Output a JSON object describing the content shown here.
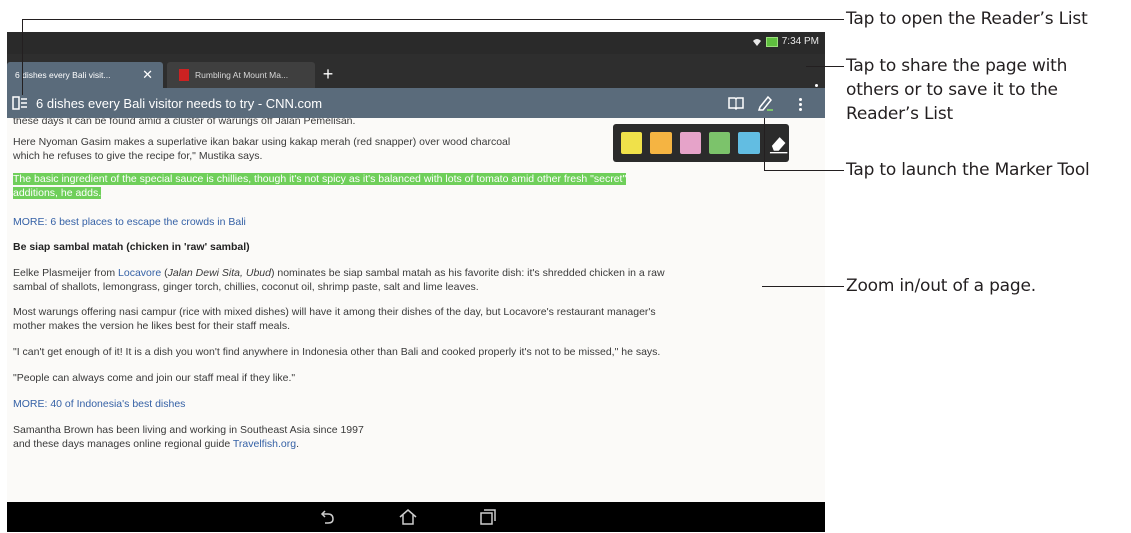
{
  "status": {
    "time": "7:34 PM"
  },
  "tabs": [
    {
      "label": "6 dishes every Bali visit...",
      "close": "✕"
    },
    {
      "label": "Rumbling At Mount Ma..."
    }
  ],
  "newtab_label": "+",
  "url_bar": {
    "title": "6 dishes every Bali visitor needs to try - CNN.com"
  },
  "article": {
    "para_top": "these days it can be found amid a cluster of warungs off Jalan Pemelisan.",
    "para_nyoman_1": "Here Nyoman Gasim makes a superlative ikan bakar using kakap merah (red snapper) over wood charcoal",
    "para_nyoman_2": "which he refuses to give the recipe for,\" Mustika says.",
    "highlight_1": "The basic ingredient of the special sauce is chillies, though it's not spicy as it's balanced with lots of tomato amid other fresh \"secret\"",
    "highlight_2": "additions, he adds.",
    "more_1": "MORE: 6 best places to escape the crowds in Bali",
    "heading": "Be siap sambal matah (chicken in 'raw' sambal)",
    "eelke_a": "Eelke Plasmeijer from ",
    "eelke_link": "Locavore",
    "eelke_b": " (",
    "eelke_italic": "Jalan Dewi Sita, Ubud",
    "eelke_c": ") nominates be siap sambal matah as his favorite dish: it's shredded chicken in a raw",
    "eelke_2": "sambal of shallots, lemongrass, ginger torch, chillies, coconut oil, shrimp paste, salt and lime leaves.",
    "warungs_1": "Most warungs offering nasi campur (rice with mixed dishes) will have it among their dishes of the day, but Locavore's restaurant manager's",
    "warungs_2": "mother makes the version he likes best for their staff meals.",
    "quote_1": "\"I can't get enough of it! It is a dish you won't find anywhere in Indonesia other than Bali and cooked properly it's not to be missed,\" he says.",
    "quote_2": "\"People can always come and join our staff meal if they like.\"",
    "more_2": "MORE: 40 of Indonesia's best dishes",
    "samantha_1": "Samantha Brown has been living and working in Southeast Asia since 1997",
    "samantha_2a": "and these days manages online regional guide ",
    "samantha_link": "Travelfish.org",
    "samantha_2b": "."
  },
  "marker_colors": [
    "#f0e14a",
    "#f5b442",
    "#e6a3c9",
    "#7cc36b",
    "#62bde2"
  ],
  "callouts": {
    "readers_list": "Tap to open the Reader’s List",
    "share_1": "Tap to share the page with",
    "share_2": "others or to save it to the",
    "share_3": "Reader’s List",
    "marker": "Tap to launch the Marker Tool",
    "zoom": "Zoom in/out of a page."
  }
}
